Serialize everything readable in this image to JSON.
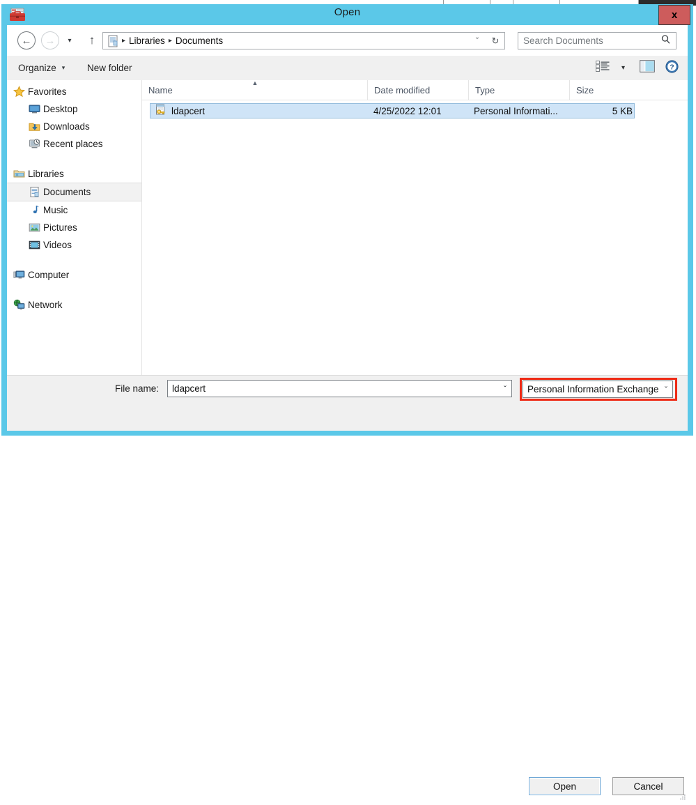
{
  "window": {
    "title": "Open",
    "app_icon": "certificate-toolbox-icon",
    "close_label": "x"
  },
  "nav": {
    "back_icon": "arrow-left-icon",
    "back_glyph": "←",
    "forward_icon": "arrow-right-icon",
    "forward_glyph": "→",
    "history_icon": "chevron-down-icon",
    "history_glyph": "▾",
    "up_icon": "arrow-up-icon",
    "up_glyph": "↑",
    "address_icon": "libraries-document-icon",
    "breadcrumbs": [
      "Libraries",
      "Documents"
    ],
    "breadcrumb_separator": "▸",
    "dropdown_glyph": "ˇ",
    "refresh_glyph": "↻"
  },
  "search": {
    "placeholder": "Search Documents",
    "icon": "search-icon",
    "icon_glyph": "⚲"
  },
  "toolbar": {
    "organize_label": "Organize",
    "organize_caret": "▾",
    "new_folder_label": "New folder",
    "view_icon": "view-list-icon",
    "view_caret": "▾",
    "preview_pane_icon": "preview-pane-icon",
    "help_icon": "help-icon"
  },
  "sidebar": {
    "groups": [
      {
        "root": {
          "label": "Favorites",
          "icon": "star-icon"
        },
        "items": [
          {
            "label": "Desktop",
            "icon": "desktop-icon",
            "selected": false
          },
          {
            "label": "Downloads",
            "icon": "downloads-icon",
            "selected": false
          },
          {
            "label": "Recent places",
            "icon": "recent-places-icon",
            "selected": false
          }
        ]
      },
      {
        "root": {
          "label": "Libraries",
          "icon": "libraries-folder-icon"
        },
        "items": [
          {
            "label": "Documents",
            "icon": "documents-icon",
            "selected": true
          },
          {
            "label": "Music",
            "icon": "music-icon",
            "selected": false
          },
          {
            "label": "Pictures",
            "icon": "pictures-icon",
            "selected": false
          },
          {
            "label": "Videos",
            "icon": "videos-icon",
            "selected": false
          }
        ]
      },
      {
        "root": {
          "label": "Computer",
          "icon": "computer-icon"
        },
        "items": []
      },
      {
        "root": {
          "label": "Network",
          "icon": "network-icon"
        },
        "items": []
      }
    ]
  },
  "filelist": {
    "columns": [
      {
        "label": "Name",
        "sorted": true,
        "sort_glyph": "▲"
      },
      {
        "label": "Date modified",
        "sorted": false
      },
      {
        "label": "Type",
        "sorted": false
      },
      {
        "label": "Size",
        "sorted": false
      }
    ],
    "rows": [
      {
        "name": "ldapcert",
        "icon": "pfx-certificate-icon",
        "date_modified": "4/25/2022 12:01",
        "type": "Personal Informati...",
        "size": "5 KB",
        "selected": true
      }
    ]
  },
  "footer": {
    "file_name_label": "File name:",
    "file_name_value": "ldapcert",
    "file_name_caret": "ˇ",
    "filter_value": "Personal Information Exchange",
    "filter_caret": "ˇ",
    "open_label": "Open",
    "cancel_label": "Cancel",
    "resize_grip": "resize-grip-icon",
    "highlight_color": "#ee2b16"
  }
}
